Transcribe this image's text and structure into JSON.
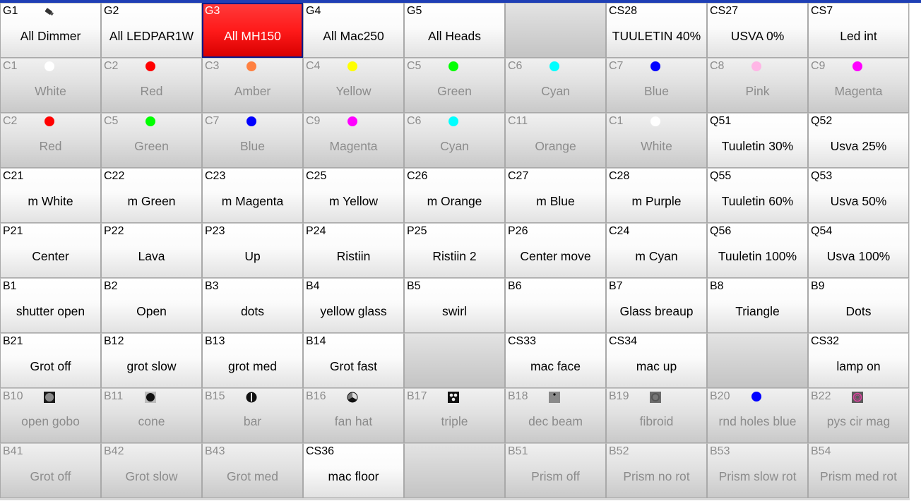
{
  "rows": [
    [
      {
        "code": "G1",
        "label": "All Dimmer",
        "state": "active",
        "icon": "fixture-icon"
      },
      {
        "code": "G2",
        "label": "All LEDPAR1W",
        "state": "active"
      },
      {
        "code": "G3",
        "label": "All MH150",
        "state": "selected"
      },
      {
        "code": "G4",
        "label": "All Mac250",
        "state": "active"
      },
      {
        "code": "G5",
        "label": "All Heads",
        "state": "active"
      },
      {
        "code": "",
        "label": "",
        "state": "empty"
      },
      {
        "code": "CS28",
        "label": "TUULETIN 40%",
        "state": "active"
      },
      {
        "code": "CS27",
        "label": "USVA 0%",
        "state": "active"
      },
      {
        "code": "CS7",
        "label": "Led int",
        "state": "active"
      }
    ],
    [
      {
        "code": "C1",
        "label": "White",
        "state": "inactive",
        "dot": "#ffffff"
      },
      {
        "code": "C2",
        "label": "Red",
        "state": "inactive",
        "dot": "#ff0000"
      },
      {
        "code": "C3",
        "label": "Amber",
        "state": "inactive",
        "dot": "#ff8040"
      },
      {
        "code": "C4",
        "label": "Yellow",
        "state": "inactive",
        "dot": "#ffff00"
      },
      {
        "code": "C5",
        "label": "Green",
        "state": "inactive",
        "dot": "#00ff00"
      },
      {
        "code": "C6",
        "label": "Cyan",
        "state": "inactive",
        "dot": "#00ffff"
      },
      {
        "code": "C7",
        "label": "Blue",
        "state": "inactive",
        "dot": "#0000ff"
      },
      {
        "code": "C8",
        "label": "Pink",
        "state": "inactive",
        "dot": "#ffb6e6"
      },
      {
        "code": "C9",
        "label": "Magenta",
        "state": "inactive",
        "dot": "#ff00ff"
      }
    ],
    [
      {
        "code": "C2",
        "label": "Red",
        "state": "inactive",
        "dot": "#ff0000"
      },
      {
        "code": "C5",
        "label": "Green",
        "state": "inactive",
        "dot": "#00ff00"
      },
      {
        "code": "C7",
        "label": "Blue",
        "state": "inactive",
        "dot": "#0000ff"
      },
      {
        "code": "C9",
        "label": "Magenta",
        "state": "inactive",
        "dot": "#ff00ff"
      },
      {
        "code": "C6",
        "label": "Cyan",
        "state": "inactive",
        "dot": "#00ffff"
      },
      {
        "code": "C11",
        "label": "Orange",
        "state": "inactive"
      },
      {
        "code": "C1",
        "label": "White",
        "state": "inactive",
        "dot": "#ffffff"
      },
      {
        "code": "Q51",
        "label": "Tuuletin 30%",
        "state": "active"
      },
      {
        "code": "Q52",
        "label": "Usva 25%",
        "state": "active"
      }
    ],
    [
      {
        "code": "C21",
        "label": "m White",
        "state": "active"
      },
      {
        "code": "C22",
        "label": "m Green",
        "state": "active"
      },
      {
        "code": "C23",
        "label": "m Magenta",
        "state": "active"
      },
      {
        "code": "C25",
        "label": "m Yellow",
        "state": "active"
      },
      {
        "code": "C26",
        "label": "m Orange",
        "state": "active"
      },
      {
        "code": "C27",
        "label": "m Blue",
        "state": "active"
      },
      {
        "code": "C28",
        "label": "m Purple",
        "state": "active"
      },
      {
        "code": "Q55",
        "label": "Tuuletin 60%",
        "state": "active"
      },
      {
        "code": "Q53",
        "label": "Usva 50%",
        "state": "active"
      }
    ],
    [
      {
        "code": "P21",
        "label": "Center",
        "state": "active"
      },
      {
        "code": "P22",
        "label": "Lava",
        "state": "active"
      },
      {
        "code": "P23",
        "label": "Up",
        "state": "active"
      },
      {
        "code": "P24",
        "label": "Ristiin",
        "state": "active"
      },
      {
        "code": "P25",
        "label": "Ristiin 2",
        "state": "active"
      },
      {
        "code": "P26",
        "label": "Center move",
        "state": "active"
      },
      {
        "code": "C24",
        "label": "m Cyan",
        "state": "active"
      },
      {
        "code": "Q56",
        "label": "Tuuletin 100%",
        "state": "active"
      },
      {
        "code": "Q54",
        "label": "Usva 100%",
        "state": "active"
      }
    ],
    [
      {
        "code": "B1",
        "label": "shutter open",
        "state": "active"
      },
      {
        "code": "B2",
        "label": "Open",
        "state": "active"
      },
      {
        "code": "B3",
        "label": "dots",
        "state": "active"
      },
      {
        "code": "B4",
        "label": "yellow glass",
        "state": "active"
      },
      {
        "code": "B5",
        "label": "swirl",
        "state": "active"
      },
      {
        "code": "B6",
        "label": "",
        "state": "active"
      },
      {
        "code": "B7",
        "label": "Glass breaup",
        "state": "active"
      },
      {
        "code": "B8",
        "label": "Triangle",
        "state": "active"
      },
      {
        "code": "B9",
        "label": "Dots",
        "state": "active"
      }
    ],
    [
      {
        "code": "B21",
        "label": "Grot off",
        "state": "active"
      },
      {
        "code": "B12",
        "label": "grot slow",
        "state": "active"
      },
      {
        "code": "B13",
        "label": "grot med",
        "state": "active"
      },
      {
        "code": "B14",
        "label": "Grot fast",
        "state": "active"
      },
      {
        "code": "",
        "label": "",
        "state": "empty"
      },
      {
        "code": "CS33",
        "label": "mac face",
        "state": "active"
      },
      {
        "code": "CS34",
        "label": "mac up",
        "state": "active"
      },
      {
        "code": "",
        "label": "",
        "state": "empty"
      },
      {
        "code": "CS32",
        "label": "lamp on",
        "state": "active"
      }
    ],
    [
      {
        "code": "B10",
        "label": "open gobo",
        "state": "inactive",
        "icon": "gobo-open-icon"
      },
      {
        "code": "B11",
        "label": "cone",
        "state": "inactive",
        "icon": "gobo-cone-icon"
      },
      {
        "code": "B15",
        "label": "bar",
        "state": "inactive",
        "icon": "gobo-bar-icon"
      },
      {
        "code": "B16",
        "label": "fan hat",
        "state": "inactive",
        "icon": "gobo-fan-icon"
      },
      {
        "code": "B17",
        "label": "triple",
        "state": "inactive",
        "icon": "gobo-triple-icon"
      },
      {
        "code": "B18",
        "label": "dec beam",
        "state": "inactive",
        "icon": "gobo-beam-icon"
      },
      {
        "code": "B19",
        "label": "fibroid",
        "state": "inactive",
        "icon": "gobo-fibroid-icon"
      },
      {
        "code": "B20",
        "label": "rnd holes blue",
        "state": "inactive",
        "dot": "#0000ff"
      },
      {
        "code": "B22",
        "label": "pys cir mag",
        "state": "inactive",
        "icon": "gobo-circle-magenta-icon"
      }
    ],
    [
      {
        "code": "B41",
        "label": "Grot off",
        "state": "inactive"
      },
      {
        "code": "B42",
        "label": "Grot slow",
        "state": "inactive"
      },
      {
        "code": "B43",
        "label": "Grot med",
        "state": "inactive"
      },
      {
        "code": "CS36",
        "label": "mac floor",
        "state": "active"
      },
      {
        "code": "",
        "label": "",
        "state": "empty"
      },
      {
        "code": "B51",
        "label": "Prism off",
        "state": "inactive"
      },
      {
        "code": "B52",
        "label": "Prism no rot",
        "state": "inactive"
      },
      {
        "code": "B53",
        "label": "Prism slow rot",
        "state": "inactive"
      },
      {
        "code": "B54",
        "label": "Prism med rot",
        "state": "inactive"
      }
    ]
  ]
}
